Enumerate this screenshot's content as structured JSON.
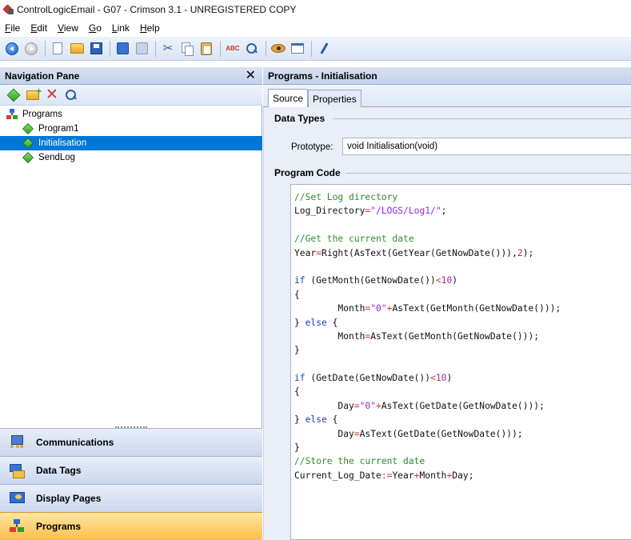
{
  "window": {
    "title": "ControlLogicEmail - G07 - Crimson 3.1 - UNREGISTERED COPY"
  },
  "menubar": {
    "items": [
      {
        "label": "File",
        "underline": "F",
        "rest": "ile"
      },
      {
        "label": "Edit",
        "underline": "E",
        "rest": "dit"
      },
      {
        "label": "View",
        "underline": "V",
        "rest": "iew"
      },
      {
        "label": "Go",
        "underline": "G",
        "rest": "o"
      },
      {
        "label": "Link",
        "underline": "L",
        "rest": "ink"
      },
      {
        "label": "Help",
        "underline": "H",
        "rest": "elp"
      }
    ]
  },
  "toolbar": {
    "icons": [
      "back-icon",
      "forward-icon",
      "new-icon",
      "open-icon",
      "save-icon",
      "import-icon",
      "export-icon",
      "cut-icon",
      "copy-icon",
      "paste-icon",
      "spell-check-icon",
      "find-icon",
      "watch-icon",
      "window-icon",
      "pen-icon"
    ],
    "spell_label": "ABC"
  },
  "nav": {
    "header": "Navigation Pane",
    "close_glyph": "✕",
    "tree": {
      "root": "Programs",
      "items": [
        "Program1",
        "Initialisation",
        "SendLog"
      ],
      "selected": "Initialisation"
    },
    "sections": [
      {
        "label": "Communications",
        "active": false
      },
      {
        "label": "Data Tags",
        "active": false
      },
      {
        "label": "Display Pages",
        "active": false
      },
      {
        "label": "Programs",
        "active": true
      }
    ],
    "colors": {
      "selection": "#0078d7",
      "active_section": "#fbbe4a"
    }
  },
  "main": {
    "header": "Programs - Initialisation",
    "tabs": [
      {
        "label": "Source",
        "active": true
      },
      {
        "label": "Properties",
        "active": false
      }
    ],
    "data_types": {
      "title": "Data Types",
      "prototype_label": "Prototype:",
      "prototype_value": "void Initialisation(void)"
    },
    "program_code": {
      "title": "Program Code",
      "lines": [
        "//Set Log directory",
        "Log_Directory=\"/LOGS/Log1/\";",
        "",
        "//Get the current date",
        "Year=Right(AsText(GetYear(GetNowDate())),2);",
        "",
        "if (GetMonth(GetNowDate())<10)",
        "{",
        "        Month=\"0\"+AsText(GetMonth(GetNowDate()));",
        "} else {",
        "        Month=AsText(GetMonth(GetNowDate()));",
        "}",
        "",
        "if (GetDate(GetNowDate())<10)",
        "{",
        "        Day=\"0\"+AsText(GetDate(GetNowDate()));",
        "} else {",
        "        Day=AsText(GetDate(GetNowDate()));",
        "}",
        "//Store the current date",
        "Current_Log_Date:=Year+Month+Day;"
      ]
    }
  }
}
